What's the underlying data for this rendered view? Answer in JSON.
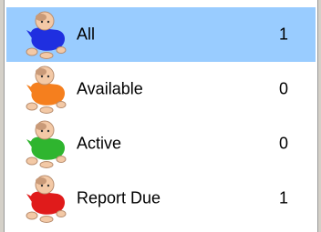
{
  "categories": [
    {
      "label": "All",
      "count": "1",
      "selected": true,
      "icon": "baby-blue-icon",
      "shirt_color": "#1f2fe0"
    },
    {
      "label": "Available",
      "count": "0",
      "selected": false,
      "icon": "baby-orange-icon",
      "shirt_color": "#f57f1e"
    },
    {
      "label": "Active",
      "count": "0",
      "selected": false,
      "icon": "baby-green-icon",
      "shirt_color": "#2fb52f"
    },
    {
      "label": "Report Due",
      "count": "1",
      "selected": false,
      "icon": "baby-red-icon",
      "shirt_color": "#e01b1b"
    }
  ],
  "colors": {
    "selection": "#99ccff",
    "frame": "#d4d0c8"
  }
}
